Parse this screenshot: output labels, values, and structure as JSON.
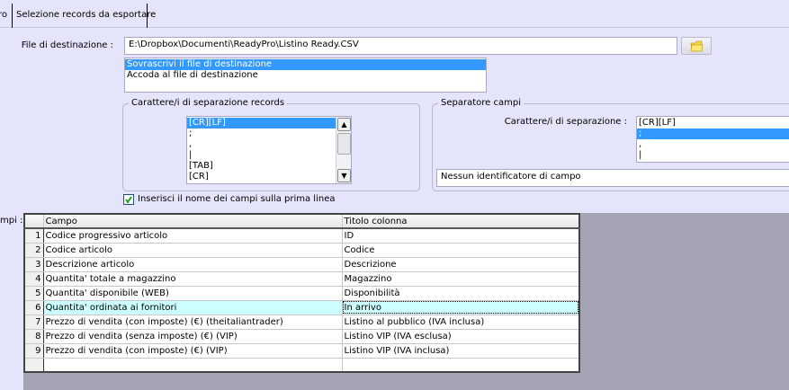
{
  "tabs": [
    {
      "label": "ro"
    },
    {
      "label": "Selezione records da esportare"
    }
  ],
  "file": {
    "label": "File di destinazione :",
    "value": "E:\\Dropbox\\Documenti\\ReadyPro\\Listino Ready.CSV",
    "browse_icon": "folder-icon"
  },
  "write_mode": {
    "options": [
      "Sovrascrivi il file di destinazione",
      "Accoda al file di destinazione"
    ],
    "selected": 0
  },
  "record_sep": {
    "title": "Carattere/i di separazione records",
    "options": [
      "[CR][LF]",
      ";",
      ",",
      "|",
      "[TAB]",
      "[CR]"
    ],
    "selected": 0
  },
  "field_sep": {
    "title": "Separatore campi",
    "label": "Carattere/i di separazione :",
    "options": [
      "[CR][LF]",
      ";",
      ",",
      "|"
    ],
    "selected": 1,
    "identifier": "Nessun identificatore di campo"
  },
  "header_checkbox": {
    "label": "Inserisci il nome dei campi sulla prima linea",
    "checked": true
  },
  "fields_label": "mpi :",
  "grid": {
    "columns": [
      "Campo",
      "Titolo colonna"
    ],
    "rows": [
      [
        "1",
        "Codice progressivo articolo",
        "ID"
      ],
      [
        "2",
        "Codice articolo",
        "Codice"
      ],
      [
        "3",
        "Descrizione articolo",
        "Descrizione"
      ],
      [
        "4",
        "Quantita' totale a magazzino",
        "Magazzino"
      ],
      [
        "5",
        "Quantita' disponibile (WEB)",
        "Disponibilità"
      ],
      [
        "6",
        "Quantita' ordinata ai fornitori",
        "In arrivo"
      ],
      [
        "7",
        "Prezzo di vendita (con imposte) (€) (theitaliantrader)",
        "Listino al pubblico (IVA inclusa)"
      ],
      [
        "8",
        "Prezzo di vendita (senza imposte) (€) (VIP)",
        "Listino VIP (IVA esclusa)"
      ],
      [
        "9",
        "Prezzo di vendita (con imposte) (€) (VIP)",
        "Listino VIP (IVA inclusa)"
      ]
    ],
    "current_row": 5
  }
}
